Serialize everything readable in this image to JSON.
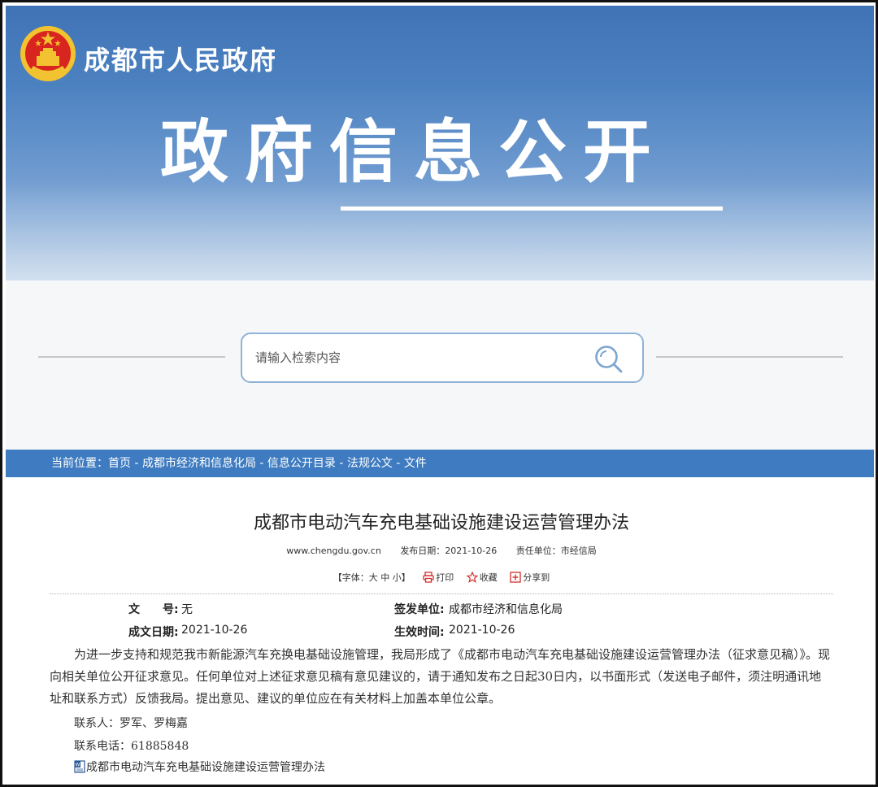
{
  "header": {
    "gov_name": "成都市人民政府",
    "banner_title": "政府信息公开"
  },
  "search": {
    "placeholder": "请输入检索内容"
  },
  "breadcrumb": {
    "prefix": "当前位置：",
    "items": [
      "首页",
      "成都市经济和信息化局",
      "信息公开目录",
      "法规公文",
      "文件"
    ],
    "separator": " - "
  },
  "article": {
    "title": "成都市电动汽车充电基础设施建设运营管理办法",
    "meta": {
      "site": "www.chengdu.gov.cn",
      "publish_label": "发布日期：",
      "publish_date": "2021-10-26",
      "unit_label": "责任单位：",
      "unit": "市经信局"
    },
    "tools": {
      "font_label": "【字体：",
      "font_large": "大",
      "font_medium": "中",
      "font_small": "小",
      "font_end": "】",
      "print": "打印",
      "favorite": "收藏",
      "share": "分享到"
    },
    "info": {
      "doc_no_label": "文　　号:",
      "doc_no": "无",
      "issuer_label": "签发单位:",
      "issuer": "成都市经济和信息化局",
      "date_label": "成文日期:",
      "date": "2021-10-26",
      "effective_label": "生效时间:",
      "effective": "2021-10-26"
    },
    "paragraph": "为进一步支持和规范我市新能源汽车充换电基础设施管理，我局形成了《成都市电动汽车充电基础设施建设运营管理办法（征求意见稿）》。现向相关单位公开征求意见。任何单位对上述征求意见稿有意见建议的，请于通知发布之日起30日内，以书面形式（发送电子邮件，须注明通讯地址和联系方式）反馈我局。提出意见、建议的单位应在有关材料上加盖本单位公章。",
    "contact_person": "联系人：罗军、罗梅嘉",
    "contact_phone": "联系电话：61885848",
    "attachment": "成都市电动汽车充电基础设施建设运营管理办法"
  },
  "colors": {
    "banner_top": "#3f73b6",
    "crumb_bar": "#3e7bc0",
    "search_border": "#8fb2d8",
    "tool_icon_red": "#d2302c"
  },
  "icons": {
    "emblem": "national-emblem",
    "search": "search-icon",
    "print": "printer-icon",
    "favorite": "star-icon",
    "share": "share-plus-icon",
    "attachment": "word-document-icon"
  }
}
